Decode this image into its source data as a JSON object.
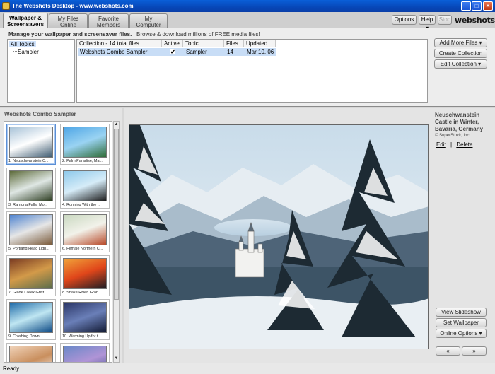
{
  "window": {
    "title": "The Webshots Desktop - www.webshots.com",
    "minimize_label": "_",
    "maximize_label": "□",
    "close_label": "×"
  },
  "tabs": [
    {
      "line1": "Wallpaper &",
      "line2": "Screensavers"
    },
    {
      "line1": "My Files",
      "line2": "Online"
    },
    {
      "line1": "Favorite",
      "line2": "Members"
    },
    {
      "line1": "My",
      "line2": "Computer"
    }
  ],
  "toolbar": {
    "options_label": "Options",
    "help_label": "Help",
    "stop_label": "Stop",
    "logo_text": "webshots"
  },
  "manage": {
    "text": "Manage your wallpaper and screensaver files.",
    "browse_link": "Browse & download millions of FREE media files!"
  },
  "tree": {
    "root": "All Topics",
    "child": "Sampler"
  },
  "collection_grid": {
    "headers": [
      "Collection - 14 total files",
      "Active",
      "Topic",
      "Files",
      "Updated"
    ],
    "rows": [
      {
        "collection": "Webshots Combo Sampler",
        "active": "✔",
        "topic": "Sampler",
        "files": "14",
        "updated": "Mar 10, 06"
      }
    ]
  },
  "side_buttons": {
    "add_more_files": "Add More Files",
    "create_collection": "Create Collection",
    "edit_collection": "Edit Collection"
  },
  "thumbnails": {
    "heading": "Webshots Combo Sampler",
    "items": [
      {
        "caption": "1. Neuschwanstein C...",
        "colors": [
          "#a9c3d8",
          "#ffffff",
          "#3f5c72"
        ]
      },
      {
        "caption": "2. Palm Paradise, Mal...",
        "colors": [
          "#4fa6e6",
          "#9ad3f2",
          "#2f6c37"
        ]
      },
      {
        "caption": "3. Ramona Falls, Mo...",
        "colors": [
          "#5d6b3a",
          "#dfe7e4",
          "#2d3d22"
        ]
      },
      {
        "caption": "4. Running With the ...",
        "colors": [
          "#8dc8ea",
          "#d6ecf8",
          "#1c1c1c"
        ]
      },
      {
        "caption": "5. Portland Head Ligh...",
        "colors": [
          "#4f84d0",
          "#e6e6e6",
          "#7a5a3a"
        ]
      },
      {
        "caption": "6. Female Northern C...",
        "colors": [
          "#c9d8c0",
          "#f2f2ea",
          "#b84a2a"
        ]
      },
      {
        "caption": "7. Glade Creek Grist ...",
        "colors": [
          "#7a3b22",
          "#d39a49",
          "#5a6d4a"
        ]
      },
      {
        "caption": "8. Snake River, Gran...",
        "colors": [
          "#f0a33a",
          "#e0461a",
          "#1d1d25"
        ]
      },
      {
        "caption": "9. Crashing Down",
        "colors": [
          "#1e6aa8",
          "#bfe6f2",
          "#0d4a86"
        ]
      },
      {
        "caption": "10. Warming Up for t...",
        "colors": [
          "#2a3566",
          "#6a7fb8",
          "#121a33"
        ]
      },
      {
        "caption": "",
        "colors": [
          "#f0d2b8",
          "#c98f5e",
          "#ffffff"
        ]
      },
      {
        "caption": "",
        "colors": [
          "#6a88c8",
          "#b094d6",
          "#3a4d8a"
        ]
      }
    ]
  },
  "viewer": {
    "title": "Neuschwanstein Castle in Winter, Bavaria, Germany",
    "copyright": "© SuperStock, Inc.",
    "edit_link": "Edit",
    "separator": "|",
    "delete_link": "Delete",
    "view_slideshow": "View Slideshow",
    "set_wallpaper": "Set Wallpaper",
    "online_options": "Online Options",
    "prev_label": "«",
    "next_label": "»"
  },
  "status": {
    "text": "Ready"
  }
}
